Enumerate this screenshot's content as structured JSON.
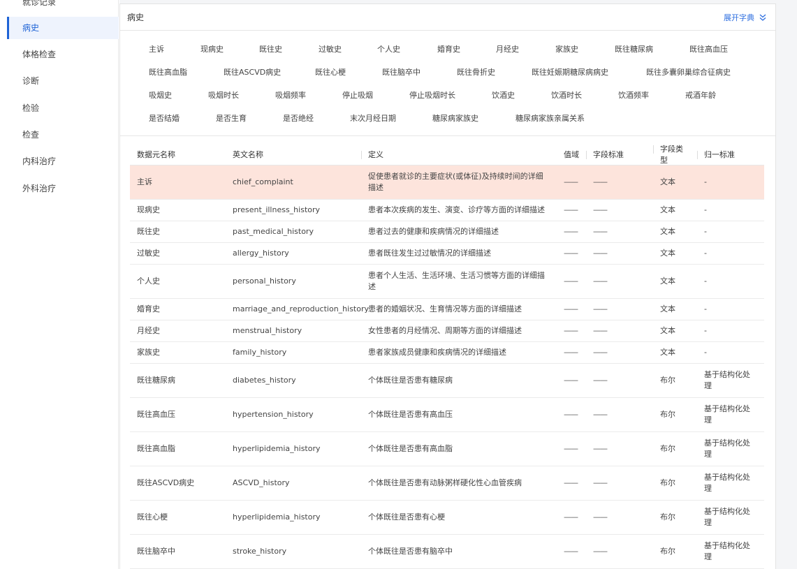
{
  "sidebar": {
    "items": [
      {
        "label": "就诊记录",
        "active": false
      },
      {
        "label": "病史",
        "active": true
      },
      {
        "label": "体格检查",
        "active": false
      },
      {
        "label": "诊断",
        "active": false
      },
      {
        "label": "检验",
        "active": false
      },
      {
        "label": "检查",
        "active": false
      },
      {
        "label": "内科治疗",
        "active": false
      },
      {
        "label": "外科治疗",
        "active": false
      }
    ]
  },
  "panel": {
    "title": "病史",
    "expand_label": "展开字典"
  },
  "tags": [
    [
      "主诉",
      "现病史",
      "既往史",
      "过敏史",
      "个人史",
      "婚育史",
      "月经史",
      "家族史",
      "既往糖尿病",
      "既往高血压"
    ],
    [
      "既往高血脂",
      "既往ASCVD病史",
      "既往心梗",
      "既往脑卒中",
      "既往骨折史",
      "既往妊娠期糖尿病病史",
      "既往多囊卵巢综合征病史"
    ],
    [
      "吸烟史",
      "吸烟时长",
      "吸烟频率",
      "停止吸烟",
      "停止吸烟时长",
      "饮酒史",
      "饮酒时长",
      "饮酒频率",
      "戒酒年龄"
    ],
    [
      "是否结婚",
      "是否生育",
      "是否绝经",
      "末次月经日期",
      "糖尿病家族史",
      "糖尿病家族亲属关系"
    ]
  ],
  "table": {
    "headers": [
      "数据元名称",
      "英文名称",
      "定义",
      "值域",
      "字段标准",
      "字段类型",
      "归一标准"
    ],
    "rows": [
      {
        "name": "主诉",
        "en": "chief_complaint",
        "def1": "促使患者就诊的主要症状(或体征)及持续时间的详细",
        "def2": "描述",
        "domain": "——",
        "std": "——",
        "type": "文本",
        "norm1": "-",
        "norm2": ""
      },
      {
        "name": "现病史",
        "en": "present_illness_history",
        "def1": "患者本次疾病的发生、演变、诊疗等方面的详细描述",
        "def2": "",
        "domain": "——",
        "std": "——",
        "type": "文本",
        "norm1": "-",
        "norm2": ""
      },
      {
        "name": "既往史",
        "en": "past_medical_history",
        "def1": "患者过去的健康和疾病情况的详细描述",
        "def2": "",
        "domain": "——",
        "std": "——",
        "type": "文本",
        "norm1": "-",
        "norm2": ""
      },
      {
        "name": "过敏史",
        "en": "allergy_history",
        "def1": "患者既往发生过过敏情况的详细描述",
        "def2": "",
        "domain": "——",
        "std": "——",
        "type": "文本",
        "norm1": "-",
        "norm2": ""
      },
      {
        "name": "个人史",
        "en": "personal_history",
        "def1": "患者个人生活、生活环境、生活习惯等方面的详细描",
        "def2": "述",
        "domain": "——",
        "std": "——",
        "type": "文本",
        "norm1": "-",
        "norm2": ""
      },
      {
        "name": "婚育史",
        "en": "marriage_and_reproduction_history",
        "def1": "患者的婚姻状况、生育情况等方面的详细描述",
        "def2": "",
        "domain": "——",
        "std": "——",
        "type": "文本",
        "norm1": "-",
        "norm2": ""
      },
      {
        "name": "月经史",
        "en": "menstrual_history",
        "def1": "女性患者的月经情况、周期等方面的详细描述",
        "def2": "",
        "domain": "——",
        "std": "——",
        "type": "文本",
        "norm1": "-",
        "norm2": ""
      },
      {
        "name": "家族史",
        "en": "family_history",
        "def1": "患者家族成员健康和疾病情况的详细描述",
        "def2": "",
        "domain": "——",
        "std": "——",
        "type": "文本",
        "norm1": "-",
        "norm2": ""
      },
      {
        "name": "既往糖尿病",
        "en": "diabetes_history",
        "def1": "个体既往是否患有糖尿病",
        "def2": "",
        "domain": "——",
        "std": "——",
        "type": "布尔",
        "norm1": "基于结构化处",
        "norm2": "理"
      },
      {
        "name": "既往高血压",
        "en": "hypertension_history",
        "def1": "个体既往是否患有高血压",
        "def2": "",
        "domain": "——",
        "std": "——",
        "type": "布尔",
        "norm1": "基于结构化处",
        "norm2": "理"
      },
      {
        "name": "既往高血脂",
        "en": "hyperlipidemia_history",
        "def1": "个体既往是否患有高血脂",
        "def2": "",
        "domain": "——",
        "std": "——",
        "type": "布尔",
        "norm1": "基于结构化处",
        "norm2": "理"
      },
      {
        "name": "既往ASCVD病史",
        "en": "ASCVD_history",
        "def1": "个体既往是否患有动脉粥样硬化性心血管疾病",
        "def2": "",
        "domain": "——",
        "std": "——",
        "type": "布尔",
        "norm1": "基于结构化处",
        "norm2": "理"
      },
      {
        "name": "既往心梗",
        "en": "hyperlipidemia_history",
        "def1": "个体既往是否患有心梗",
        "def2": "",
        "domain": "——",
        "std": "——",
        "type": "布尔",
        "norm1": "基于结构化处",
        "norm2": "理"
      },
      {
        "name": "既往脑卒中",
        "en": "stroke_history",
        "def1": "个体既往是否患有脑卒中",
        "def2": "",
        "domain": "——",
        "std": "——",
        "type": "布尔",
        "norm1": "基于结构化处",
        "norm2": "理"
      }
    ]
  },
  "colors": {
    "accent": "#1e63d6",
    "highlight_row": "#fde4dc",
    "sidebar_active_bg": "#eef3fd"
  },
  "icons": {
    "expand": "chevron-double-down-icon"
  }
}
